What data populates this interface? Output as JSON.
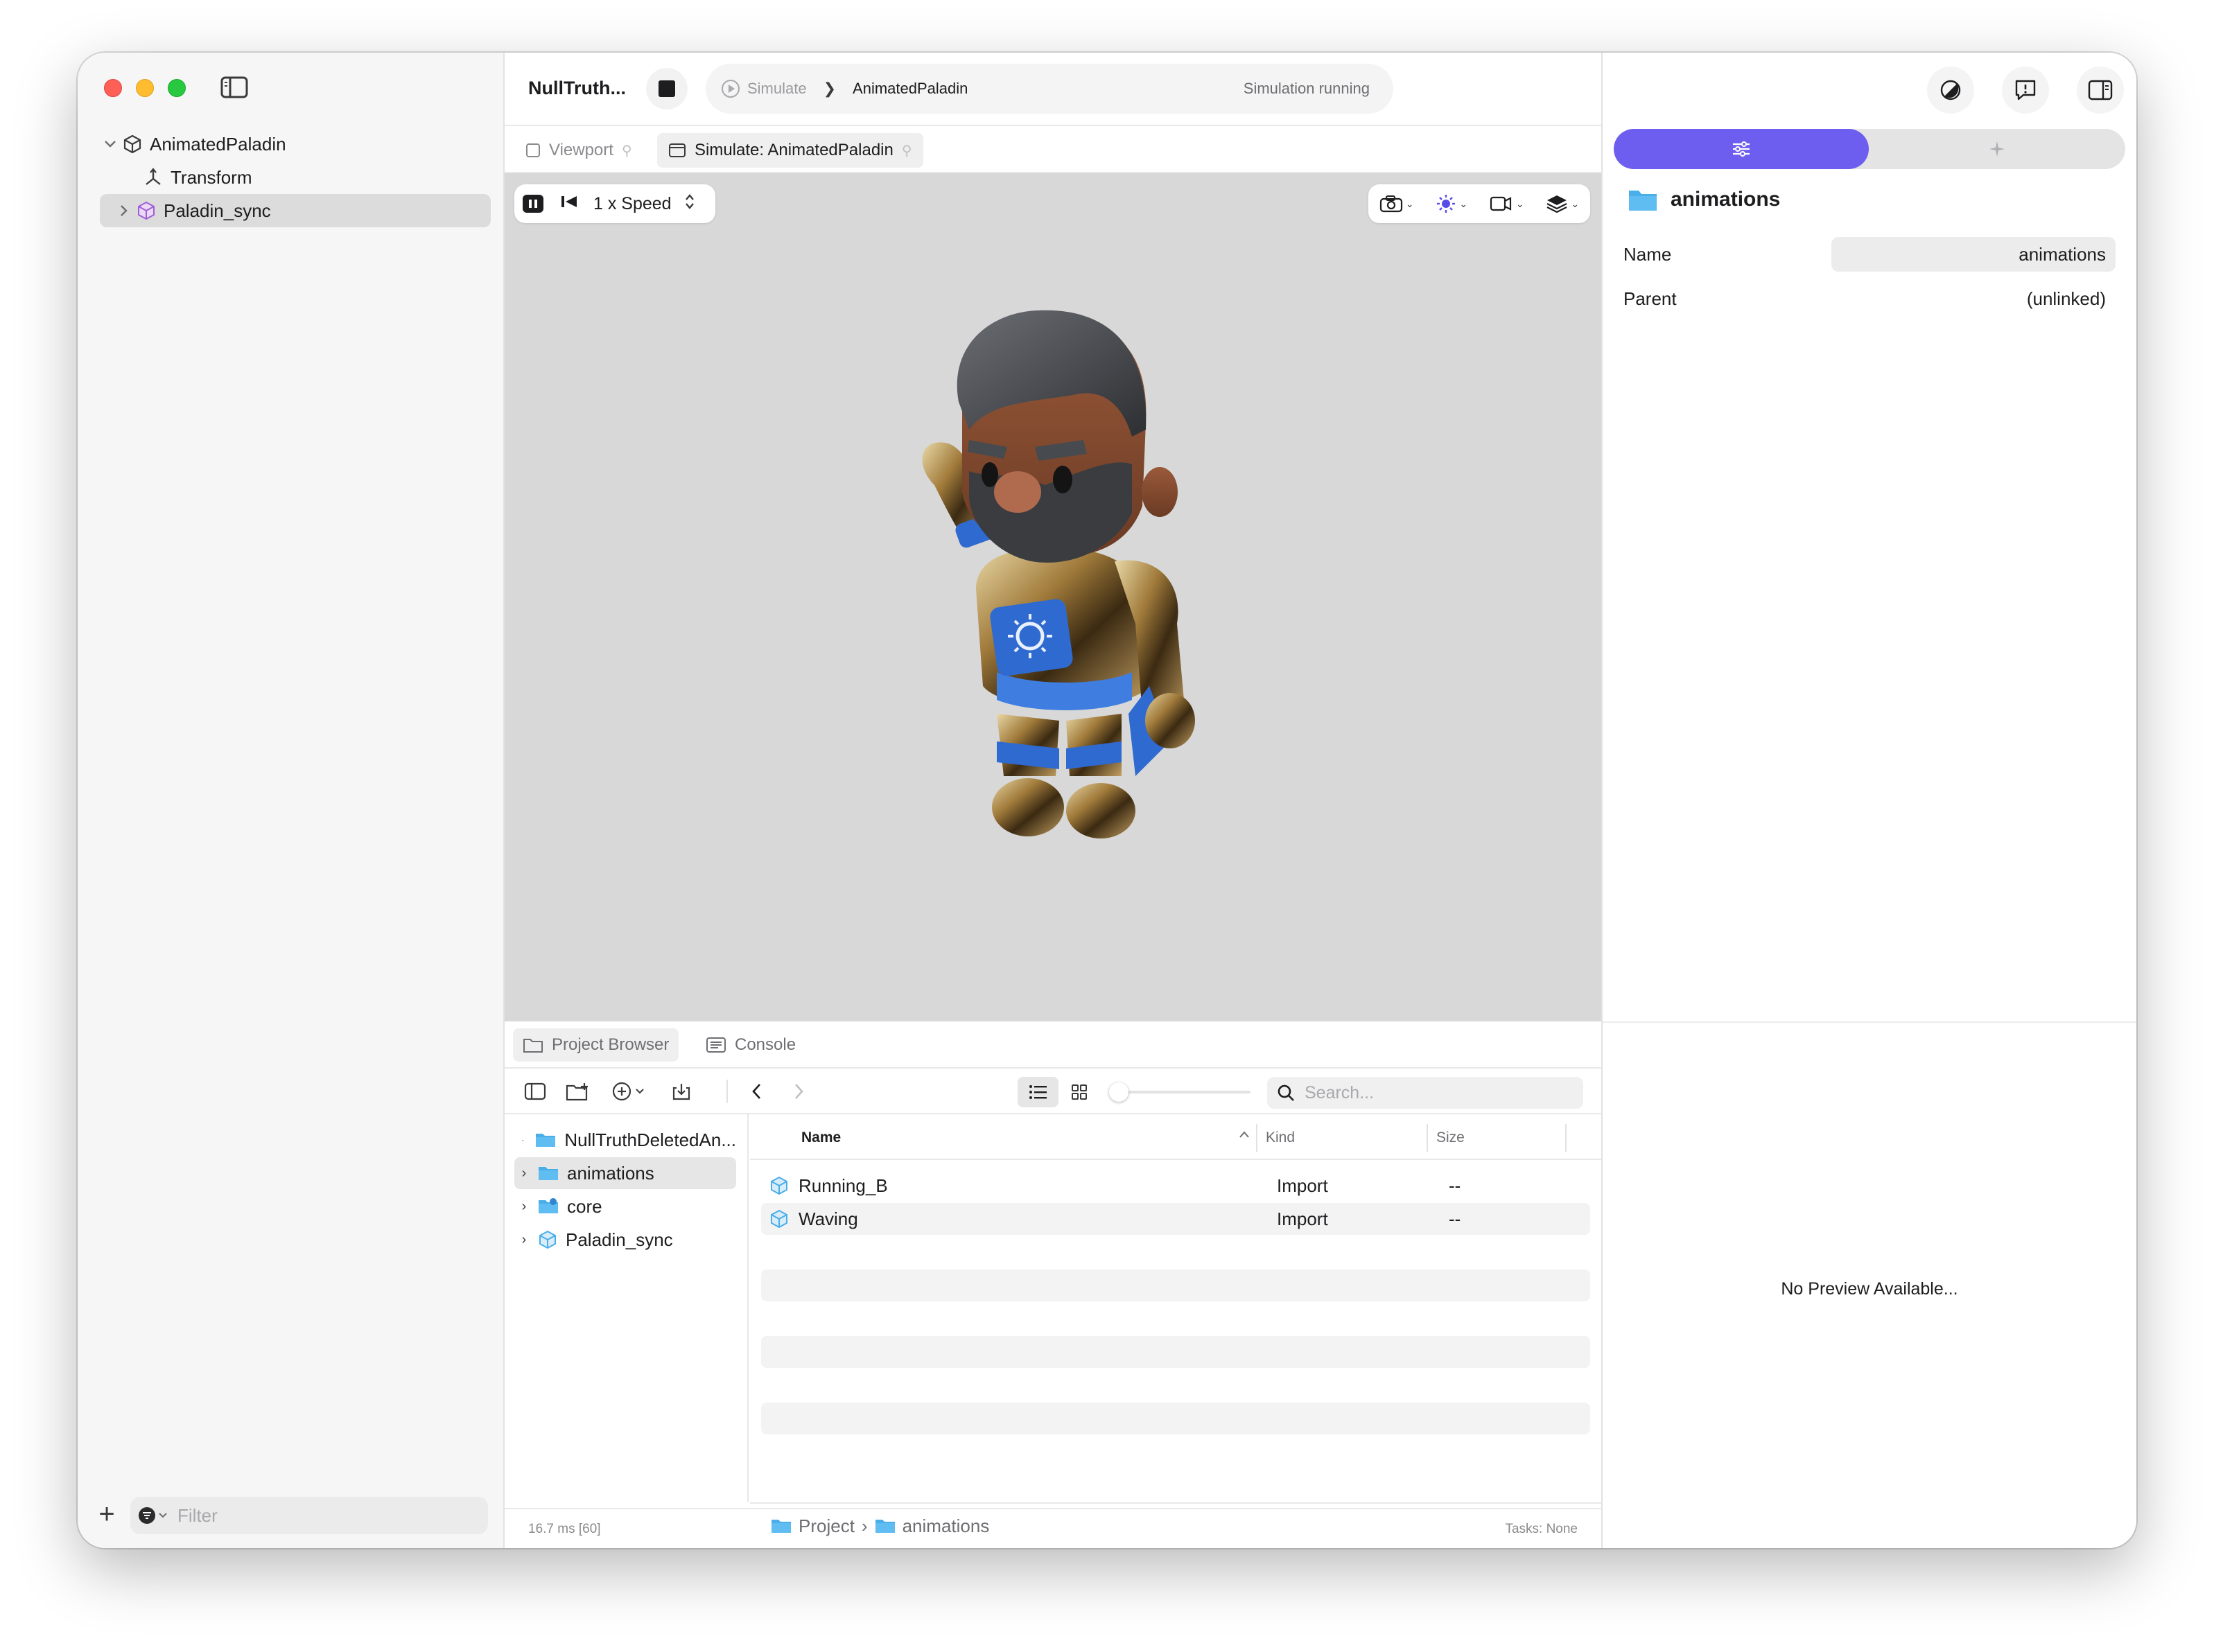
{
  "sidebar": {
    "tree": [
      {
        "label": "AnimatedPaladin",
        "icon": "cube-icon"
      },
      {
        "label": "Transform",
        "icon": "transform-icon"
      },
      {
        "label": "Paladin_sync",
        "icon": "model-icon"
      }
    ],
    "filter_placeholder": "Filter"
  },
  "toolbar": {
    "project_title": "NullTruth...",
    "simulate_label": "Simulate",
    "target": "AnimatedPaladin",
    "status": "Simulation running"
  },
  "tabs": [
    {
      "label": "Viewport"
    },
    {
      "label": "Simulate: AnimatedPaladin"
    }
  ],
  "viewport": {
    "speed": "1 x Speed"
  },
  "bottom_panel": {
    "tabs": [
      {
        "label": "Project Browser"
      },
      {
        "label": "Console"
      }
    ],
    "search_placeholder": "Search...",
    "folders": [
      {
        "label": "NullTruthDeletedAn..."
      },
      {
        "label": "animations"
      },
      {
        "label": "core"
      },
      {
        "label": "Paladin_sync"
      }
    ],
    "columns": {
      "name": "Name",
      "kind": "Kind",
      "size": "Size"
    },
    "files": [
      {
        "name": "Running_B",
        "kind": "Import",
        "size": "--"
      },
      {
        "name": "Waving",
        "kind": "Import",
        "size": "--"
      }
    ],
    "path": {
      "root": "Project",
      "sep": "›",
      "current": "animations"
    },
    "status_left": "16.7 ms [60]",
    "status_right": "Tasks: None"
  },
  "inspector": {
    "title": "animations",
    "props": [
      {
        "label": "Name",
        "value": "animations"
      },
      {
        "label": "Parent",
        "value": "(unlinked)"
      }
    ],
    "preview_text": "No Preview Available..."
  },
  "colors": {
    "accent": "#6e5ef0",
    "folder": "#4aaee8",
    "viewport_bg": "#d8d8d8"
  }
}
